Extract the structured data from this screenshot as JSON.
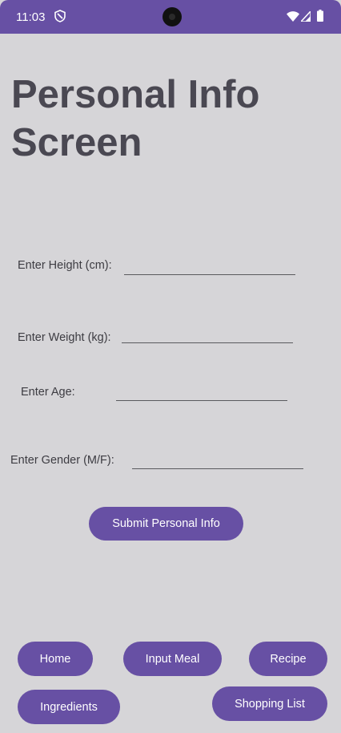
{
  "status_bar": {
    "time": "11:03",
    "background": "#6750a4",
    "icons": [
      "shield-icon",
      "camera-cutout",
      "wifi-icon",
      "signal-icon",
      "battery-icon"
    ]
  },
  "title": {
    "line1": "Personal Info",
    "line2": "Screen"
  },
  "form": {
    "height_label": "Enter Height (cm):",
    "weight_label": "Enter Weight (kg):",
    "age_label": "Enter Age:",
    "gender_label": "Enter Gender (M/F):"
  },
  "submit_label": "Submit Personal Info",
  "nav": {
    "home": "Home",
    "input_meal": "Input Meal",
    "recipe": "Recipe",
    "ingredients": "Ingredients",
    "shopping_list": "Shopping List"
  },
  "colors": {
    "accent": "#6750a4",
    "background": "#d6d5d8",
    "title_text": "#4a4852"
  }
}
